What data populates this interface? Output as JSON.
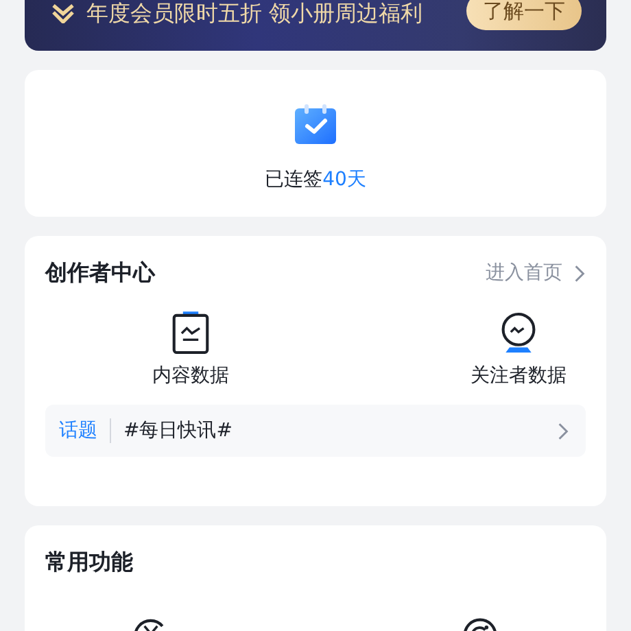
{
  "banner": {
    "text": "年度会员限时五折 领小册周边福利",
    "button": "了解一下"
  },
  "checkin": {
    "text": "已连签",
    "days": "40天"
  },
  "creator": {
    "title": "创作者中心",
    "link": "进入首页",
    "items": [
      {
        "label": "内容数据",
        "kind": "content"
      },
      {
        "label": "关注者数据",
        "kind": "followers"
      }
    ],
    "topic": {
      "tag": "话题",
      "text": "#每日快讯#"
    }
  },
  "common": {
    "title": "常用功能",
    "items": [
      {
        "kind": "money"
      },
      {
        "kind": "refresh"
      }
    ]
  }
}
